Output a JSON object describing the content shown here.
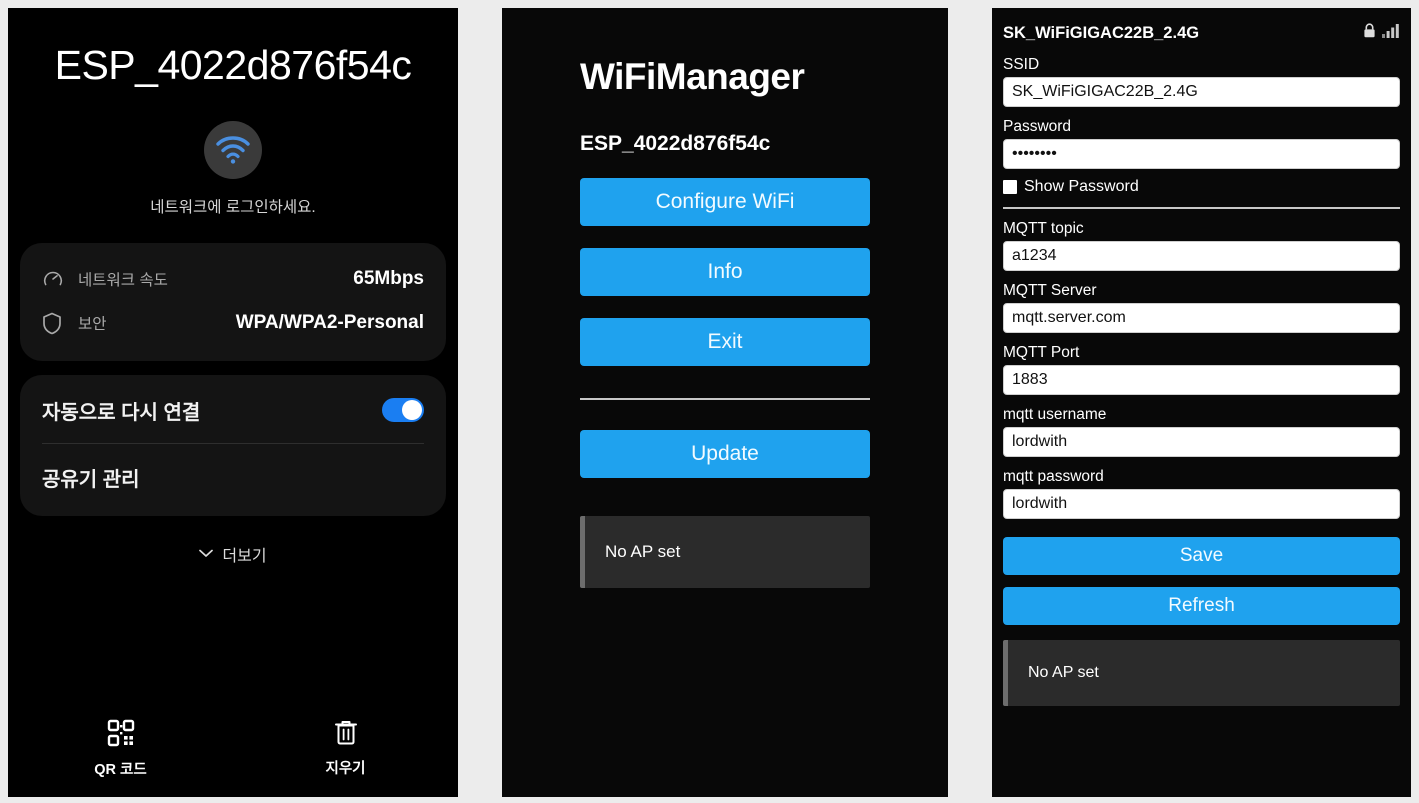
{
  "panel1": {
    "network_name": "ESP_4022d876f54c",
    "wifi_icon": "wifi-icon",
    "login_prompt": "네트워크에 로그인하세요.",
    "info_rows": [
      {
        "icon": "speedometer-icon",
        "label": "네트워크 속도",
        "value": "65Mbps"
      },
      {
        "icon": "shield-icon",
        "label": "보안",
        "value": "WPA/WPA2-Personal"
      }
    ],
    "settings_rows": [
      {
        "label": "자동으로 다시 연결",
        "toggle": true
      },
      {
        "label": "공유기 관리",
        "toggle": false
      }
    ],
    "more_label": "더보기",
    "more_icon": "chevron-down-icon",
    "bottom_bar": [
      {
        "icon": "qr-code-icon",
        "label": "QR 코드"
      },
      {
        "icon": "trash-icon",
        "label": "지우기"
      }
    ]
  },
  "panel2": {
    "title": "WiFiManager",
    "subtitle": "ESP_4022d876f54c",
    "buttons": [
      {
        "label": "Configure WiFi"
      },
      {
        "label": "Info"
      },
      {
        "label": "Exit"
      }
    ],
    "update_button": "Update",
    "status_message": "No AP set"
  },
  "panel3": {
    "header": {
      "ssid": "SK_WiFiGIGAC22B_2.4G",
      "lock_icon": "lock-icon",
      "signal_icon": "signal-bars-icon"
    },
    "fields": [
      {
        "label": "SSID",
        "value": "SK_WiFiGIGAC22B_2.4G",
        "name": "ssid-input"
      },
      {
        "label": "Password",
        "value": "••••••••",
        "name": "password-input"
      }
    ],
    "show_password": {
      "label": "Show Password",
      "checked": false
    },
    "mqtt_fields": [
      {
        "label": "MQTT topic",
        "value": "a1234",
        "name": "mqtt-topic-input"
      },
      {
        "label": "MQTT Server",
        "value": "mqtt.server.com",
        "name": "mqtt-server-input"
      },
      {
        "label": "MQTT Port",
        "value": "1883",
        "name": "mqtt-port-input"
      },
      {
        "label": "mqtt username",
        "value": "lordwith",
        "name": "mqtt-username-input"
      },
      {
        "label": "mqtt password",
        "value": "lordwith",
        "name": "mqtt-password-input"
      }
    ],
    "save_button": "Save",
    "refresh_button": "Refresh",
    "status_message": "No AP set"
  },
  "colors": {
    "accent_blue": "#1fa2ee",
    "toggle_blue": "#1a7ef2",
    "panel_bg": "#080808",
    "card_bg": "#141414",
    "msg_bg": "#2b2b2b"
  }
}
